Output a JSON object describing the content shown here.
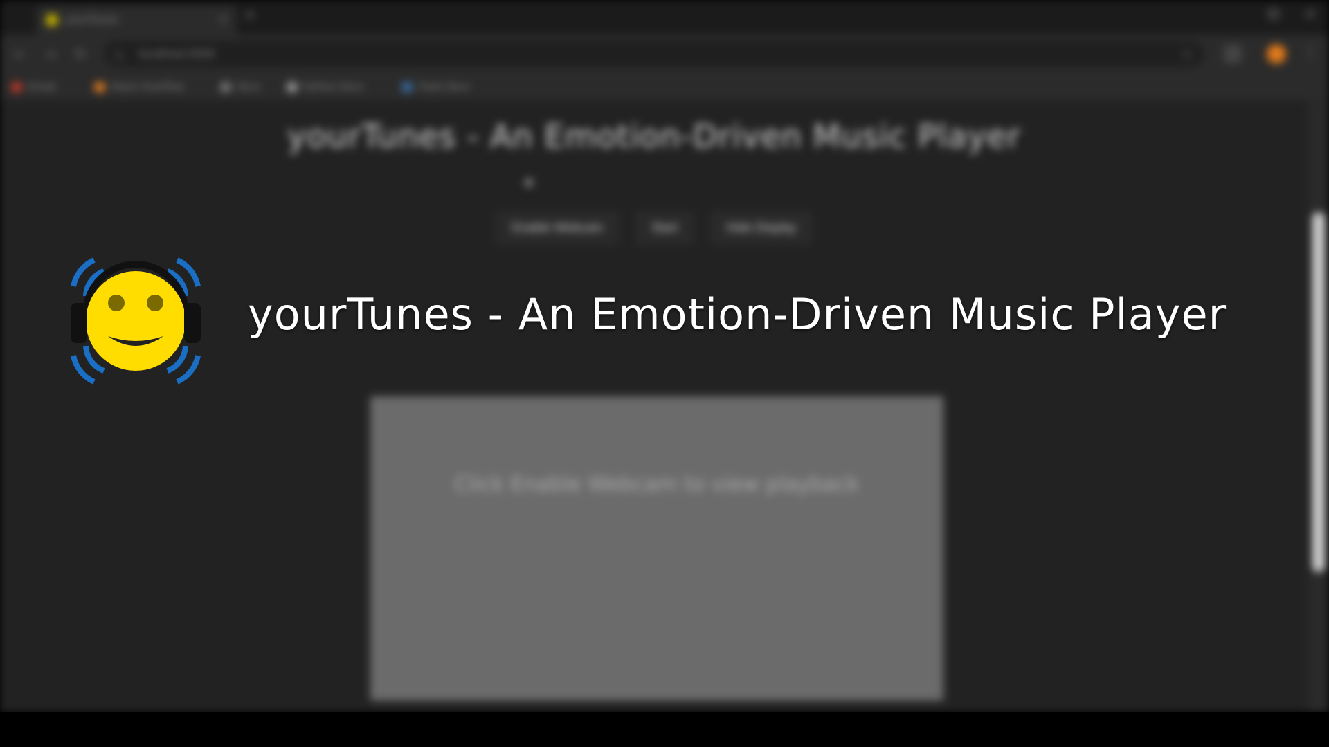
{
  "browser": {
    "tab_title": "yourTunes",
    "tab_close": "×",
    "new_tab": "+",
    "window_close": "×",
    "nav": {
      "back": "←",
      "forward": "→",
      "reload": "↻"
    },
    "address_icon": "ⓘ",
    "url": "localhost:5000",
    "star": "☆",
    "menu": "⋮",
    "bookmarks": [
      {
        "label": "Gmail",
        "color": "#c0392b"
      },
      {
        "label": "Stack Overflow",
        "color": "#e67e22"
      },
      {
        "label": "Docs",
        "color": "#777777"
      },
      {
        "label": "Python Docs",
        "color": "#9a9a9a"
      },
      {
        "label": "Flask Docs",
        "color": "#3a6ea5"
      }
    ]
  },
  "page": {
    "heading": "yourTunes - An Emotion-Driven Music Player",
    "buttons": [
      "Enable Webcam",
      "Start",
      "Hide Display"
    ],
    "video_message": "Click Enable Webcam to view playback"
  },
  "overlay": {
    "title": "yourTunes - An Emotion-Driven Music Player",
    "logo_icon": "smiley-headphones-icon",
    "colors": {
      "face": "#ffdd00",
      "waves": "#1a6fc4",
      "headphones": "#111111"
    }
  }
}
